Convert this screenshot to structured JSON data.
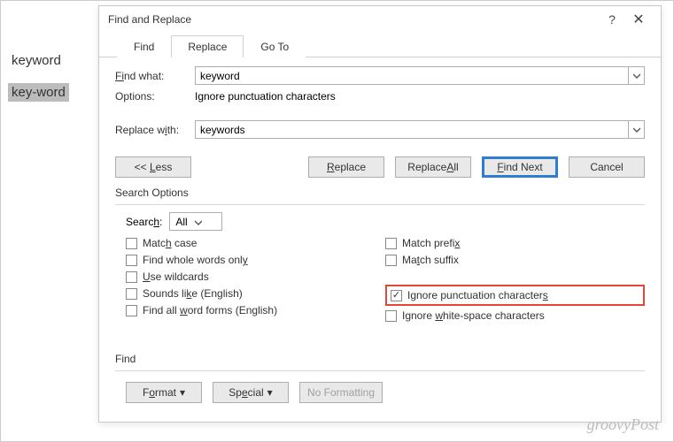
{
  "document": {
    "word1": "keyword",
    "word2": "key-word"
  },
  "dialog": {
    "title": "Find and Replace",
    "tabs": {
      "find": "Find",
      "replace": "Replace",
      "goto": "Go To"
    },
    "findwhat_label": "Find what:",
    "findwhat_value": "keyword",
    "options_label": "Options:",
    "options_value": "Ignore punctuation characters",
    "replacewith_label": "Replace with:",
    "replacewith_value": "keywords",
    "buttons": {
      "less": "<< Less",
      "replace": "Replace",
      "replace_all": "Replace All",
      "find_next": "Find Next",
      "cancel": "Cancel",
      "format": "Format",
      "special": "Special",
      "no_formatting": "No Formatting"
    },
    "search_options_label": "Search Options",
    "search_label": "Search:",
    "search_value": "All",
    "checks": {
      "match_case": "Match case",
      "whole_words": "Find whole words only",
      "wildcards": "Use wildcards",
      "sounds_like": "Sounds like (English)",
      "word_forms": "Find all word forms (English)",
      "prefix": "Match prefix",
      "suffix": "Match suffix",
      "ignore_punct": "Ignore punctuation characters",
      "ignore_ws": "Ignore white-space characters"
    },
    "find_label": "Find"
  },
  "watermark": "groovyPost"
}
